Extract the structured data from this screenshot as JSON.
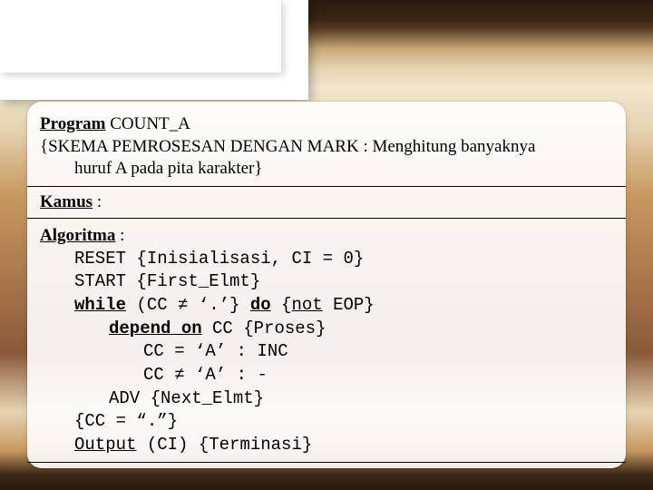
{
  "header": {
    "program_kw": "Program",
    "program_name": " COUNT_A",
    "desc_line1": "{SKEMA PEMROSESAN DENGAN MARK : Menghitung banyaknya",
    "desc_line2": "huruf A pada pita karakter}"
  },
  "kamus": {
    "kw": "Kamus",
    "rest": " :"
  },
  "alg": {
    "kw": "Algoritma",
    "rest": " :",
    "l1a": "RESET  {Inisialisasi, CI = 0}",
    "l2a": "START   {First_Elmt}",
    "l3_while": "while",
    "l3_mid": " (CC ≠ ‘.’} ",
    "l3_do": "do",
    "l3_end1": "     {",
    "l3_not": "not",
    "l3_end2": " EOP}",
    "l4_depend": "depend on",
    "l4_rest": " CC     {Proses}",
    "l5": "CC = ‘A’ : INC",
    "l6": "CC ≠ ‘A’ : -",
    "l7": "ADV    {Next_Elmt}",
    "l8": "{CC = “.”}",
    "l9_out": "Output",
    "l9_rest": " (CI)     {Terminasi}"
  }
}
